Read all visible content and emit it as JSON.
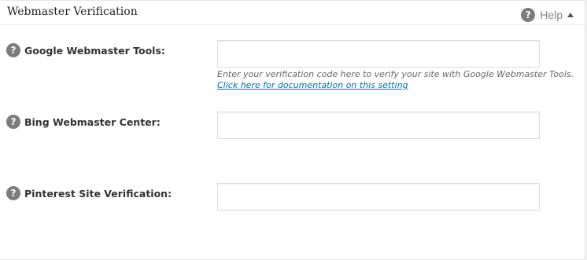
{
  "panel": {
    "title": "Webmaster Verification",
    "help_label": "Help"
  },
  "fields": [
    {
      "label": "Google Webmaster Tools:",
      "value": "",
      "description": "Enter your verification code here to verify your site with Google Webmaster Tools.",
      "link_text": "Click here for documentation on this setting"
    },
    {
      "label": "Bing Webmaster Center:",
      "value": ""
    },
    {
      "label": "Pinterest Site Verification:",
      "value": ""
    }
  ],
  "icons": {
    "help": "question-mark-icon",
    "toggle": "arrow-up-icon"
  },
  "colors": {
    "icon_gray": "#7c7c7c",
    "link_blue": "#0073aa"
  }
}
